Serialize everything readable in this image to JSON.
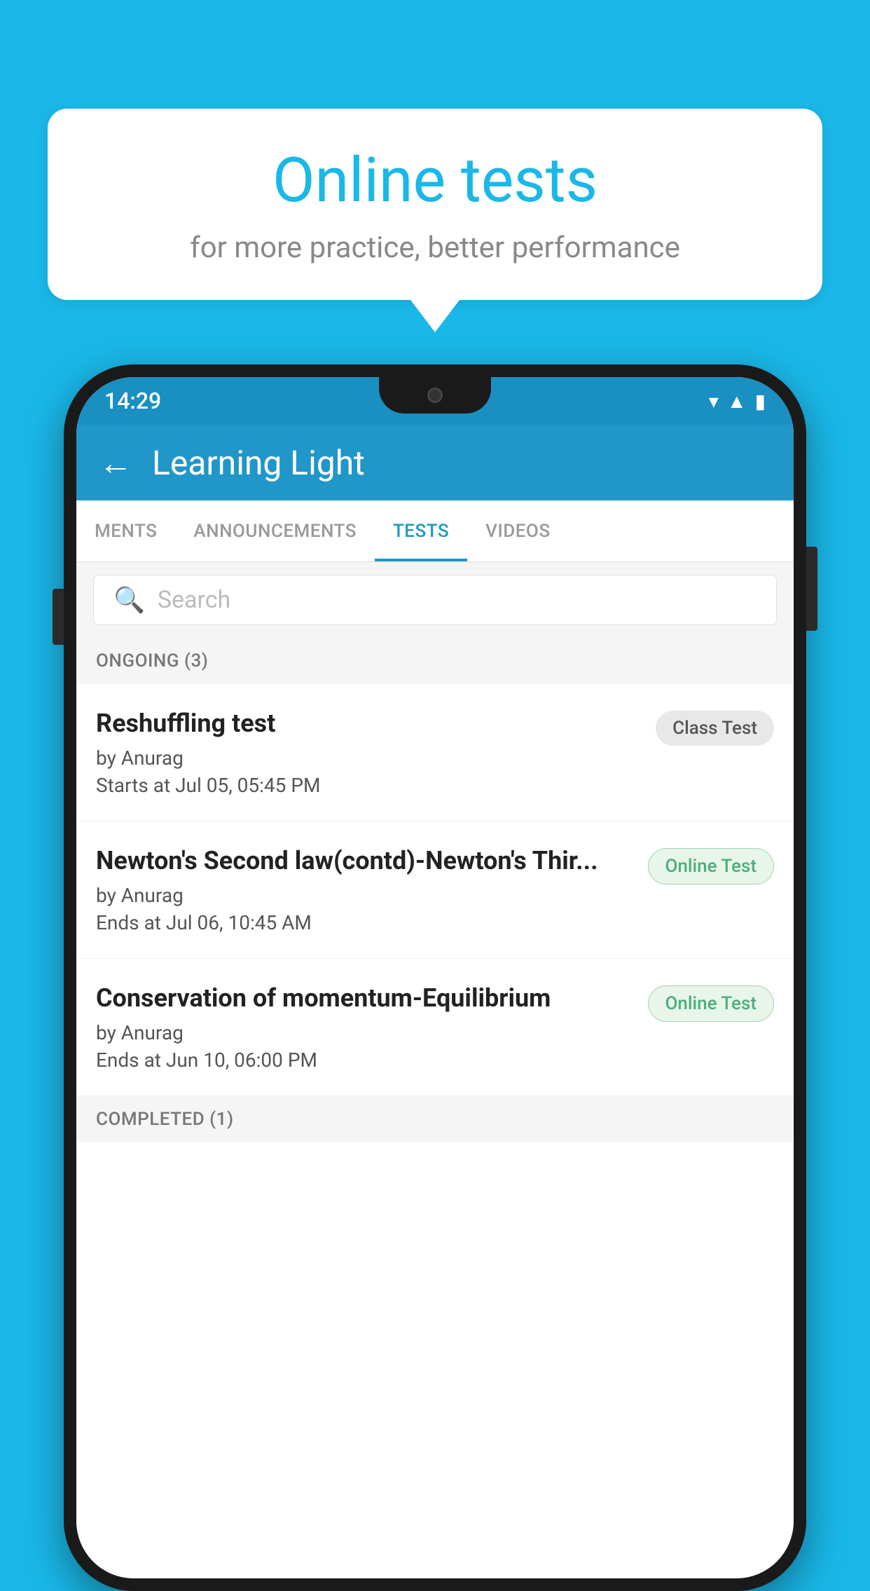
{
  "background_color": "#1ab8e8",
  "bubble": {
    "title": "Online tests",
    "subtitle": "for more practice, better performance"
  },
  "phone": {
    "status_bar": {
      "time": "14:29",
      "wifi": "▾",
      "signal": "▲",
      "battery": "▮"
    },
    "app_bar": {
      "title": "Learning Light",
      "back_label": "←"
    },
    "tabs": [
      {
        "label": "MENTS",
        "active": false
      },
      {
        "label": "ANNOUNCEMENTS",
        "active": false
      },
      {
        "label": "TESTS",
        "active": true
      },
      {
        "label": "VIDEOS",
        "active": false
      }
    ],
    "search": {
      "placeholder": "Search"
    },
    "section_ongoing": {
      "label": "ONGOING (3)"
    },
    "tests": [
      {
        "name": "Reshuffling test",
        "author": "by Anurag",
        "time_label": "Starts at",
        "time": "Jul 05, 05:45 PM",
        "badge": "Class Test",
        "badge_type": "class"
      },
      {
        "name": "Newton's Second law(contd)-Newton's Thir...",
        "author": "by Anurag",
        "time_label": "Ends at",
        "time": "Jul 06, 10:45 AM",
        "badge": "Online Test",
        "badge_type": "online"
      },
      {
        "name": "Conservation of momentum-Equilibrium",
        "author": "by Anurag",
        "time_label": "Ends at",
        "time": "Jun 10, 06:00 PM",
        "badge": "Online Test",
        "badge_type": "online"
      }
    ],
    "section_completed": {
      "label": "COMPLETED (1)"
    }
  }
}
